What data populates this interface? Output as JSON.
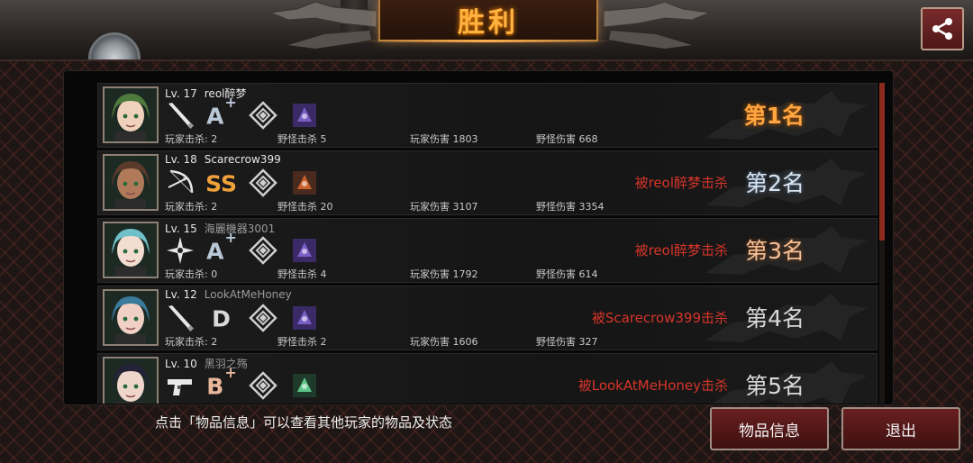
{
  "header": {
    "title": "胜利"
  },
  "footer": {
    "hint": "点击「物品信息」可以查看其他玩家的物品及状态",
    "items_button": "物品信息",
    "exit_button": "退出"
  },
  "stat_labels": {
    "player_kills": "玩家击杀:",
    "monster_kills": "野怪击杀",
    "player_damage": "玩家伤害",
    "monster_damage": "野怪伤害"
  },
  "players": [
    {
      "level": "Lv. 17",
      "name": "reol醉梦",
      "weapon_icon": "bat-icon",
      "grade": "A",
      "grade_plus": "+",
      "grade_color": "#b9c8d6",
      "player_kills": "2",
      "monster_kills": "5",
      "player_damage": "1803",
      "monster_damage": "668",
      "killed_by": "",
      "rank": "第1名",
      "rank_style": "gold"
    },
    {
      "level": "Lv. 18",
      "name": "Scarecrow399",
      "weapon_icon": "bow-icon",
      "grade": "SS",
      "grade_plus": "",
      "grade_color": "#f0a13a",
      "player_kills": "2",
      "monster_kills": "20",
      "player_damage": "3107",
      "monster_damage": "3354",
      "killed_by": "被reol醉梦击杀",
      "rank": "第2名",
      "rank_style": "silver"
    },
    {
      "level": "Lv. 15",
      "name": "海麗機器3001",
      "weapon_icon": "shuriken-icon",
      "grade": "A",
      "grade_plus": "+",
      "grade_color": "#b9c8d6",
      "player_kills": "0",
      "monster_kills": "4",
      "player_damage": "1792",
      "monster_damage": "614",
      "killed_by": "被reol醉梦击杀",
      "rank": "第3名",
      "rank_style": "bronze"
    },
    {
      "level": "Lv. 12",
      "name": "LookAtMeHoney",
      "weapon_icon": "bat-icon",
      "grade": "D",
      "grade_plus": "",
      "grade_color": "#d9d9d9",
      "player_kills": "2",
      "monster_kills": "2",
      "player_damage": "1606",
      "monster_damage": "327",
      "killed_by": "被Scarecrow399击杀",
      "rank": "第4名",
      "rank_style": "plain"
    },
    {
      "level": "Lv. 10",
      "name": "黑羽之殇",
      "weapon_icon": "pistol-icon",
      "grade": "B",
      "grade_plus": "+",
      "grade_color": "#e8b79a",
      "player_kills": "",
      "monster_kills": "",
      "player_damage": "",
      "monster_damage": "",
      "killed_by": "被LookAtMeHoney击杀",
      "rank": "第5名",
      "rank_style": "plain"
    }
  ]
}
